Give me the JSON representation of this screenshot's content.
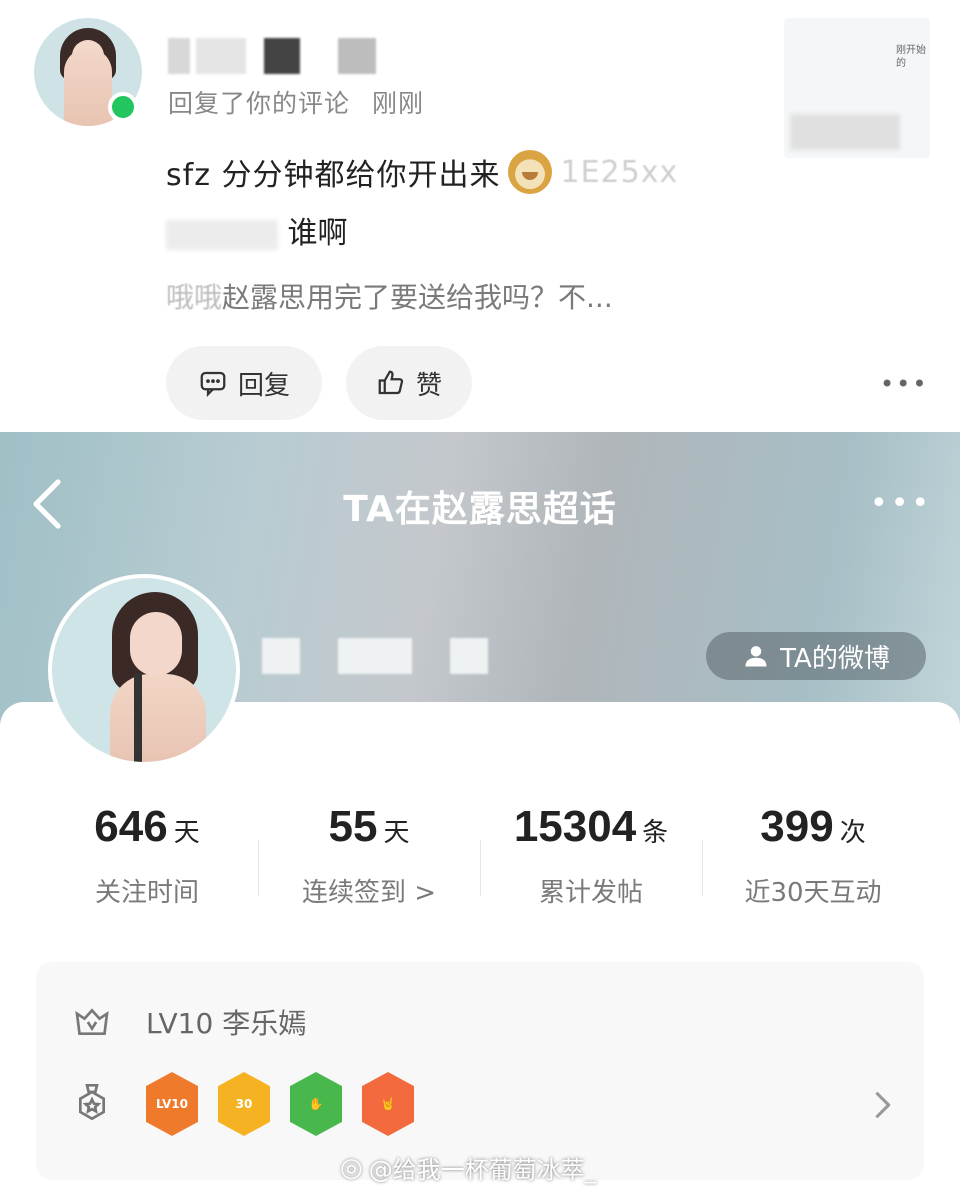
{
  "notification": {
    "subtitle_action": "回复了你的评论",
    "subtitle_time": "刚刚",
    "thumb_text": "刚开始的",
    "comment_text": "sfz 分分钟都给你开出来",
    "comment_faded": "1E25xx",
    "quote_who": "谁啊",
    "quote_context_faded": "哦哦",
    "quote_context": "赵露思用完了要送给我吗？不...",
    "reply_label": "回复",
    "like_label": "赞",
    "more_label": "•••"
  },
  "profile": {
    "title": "TA在赵露思超话",
    "more_label": "•••",
    "weibo_button": "TA的微博",
    "stats": [
      {
        "value": "646",
        "unit": "天",
        "label": "关注时间"
      },
      {
        "value": "55",
        "unit": "天",
        "label": "连续签到 >"
      },
      {
        "value": "15304",
        "unit": "条",
        "label": "累计发帖"
      },
      {
        "value": "399",
        "unit": "次",
        "label": "近30天互动"
      }
    ],
    "level_text": "LV10 李乐嫣",
    "badges": [
      {
        "name": "lv10-badge",
        "text": "LV10",
        "color": "#f07a2c"
      },
      {
        "name": "days-30-badge",
        "text": "30",
        "color": "#f5b324"
      },
      {
        "name": "hand-badge",
        "text": "✋",
        "color": "#49b84c"
      },
      {
        "name": "rock-hand-badge",
        "text": "🤘",
        "color": "#f26a3d"
      }
    ]
  },
  "watermark": "@给我一杯葡萄冰萃_"
}
